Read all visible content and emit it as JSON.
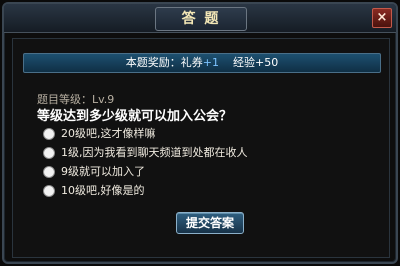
{
  "window": {
    "title": "答 题",
    "close_glyph": "×"
  },
  "reward": {
    "prefix": "本题奖励：礼券",
    "coupon": "+1",
    "exp_label": "经验",
    "exp": "+50"
  },
  "question": {
    "level": "题目等级：Lv.9",
    "text": "等级达到多少级就可以加入公会？",
    "options": [
      {
        "label": "20级吧,这才像样嘛",
        "selected": false
      },
      {
        "label": "1级,因为我看到聊天频道到处都在收人",
        "selected": false
      },
      {
        "label": "9级就可以加入了",
        "selected": false
      },
      {
        "label": "10级吧,好像是的",
        "selected": false
      }
    ]
  },
  "submit": {
    "label": "提交答案"
  },
  "colors": {
    "title_text": "#f3e7b6",
    "reward_plus": "#7cc3ff",
    "close_bg": "#8a2b22"
  }
}
